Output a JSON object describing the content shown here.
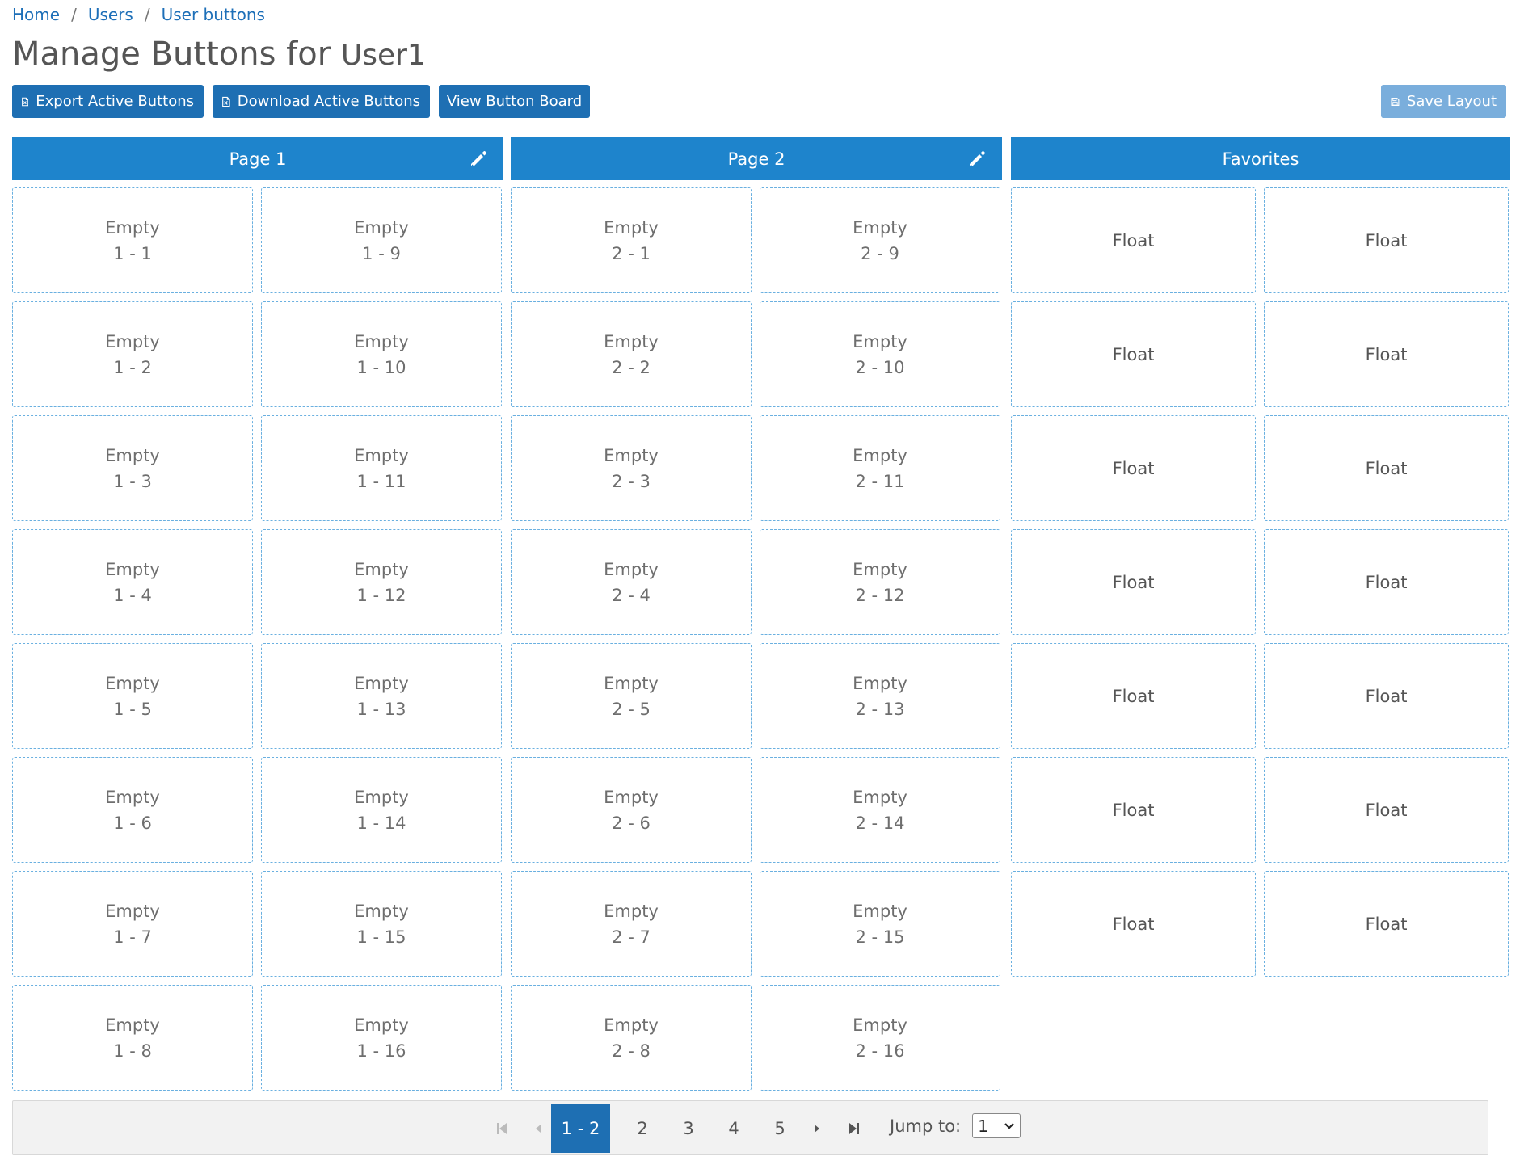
{
  "breadcrumb": {
    "home": "Home",
    "users": "Users",
    "current": "User buttons",
    "separator": "/"
  },
  "title": {
    "prefix": "Manage Buttons for",
    "user": "User1"
  },
  "toolbar": {
    "export_label": "Export Active Buttons",
    "download_label": "Download Active Buttons",
    "board_label": "View Button Board",
    "save_label": "Save Layout"
  },
  "columns": {
    "page1": "Page 1",
    "page2": "Page 2",
    "favorites": "Favorites"
  },
  "cell_status": "Empty",
  "page1_slots": [
    "1 - 1",
    "1 - 2",
    "1 - 3",
    "1 - 4",
    "1 - 5",
    "1 - 6",
    "1 - 7",
    "1 - 8",
    "1 - 9",
    "1 - 10",
    "1 - 11",
    "1 - 12",
    "1 - 13",
    "1 - 14",
    "1 - 15",
    "1 - 16"
  ],
  "page2_slots": [
    "2 - 1",
    "2 - 2",
    "2 - 3",
    "2 - 4",
    "2 - 5",
    "2 - 6",
    "2 - 7",
    "2 - 8",
    "2 - 9",
    "2 - 10",
    "2 - 11",
    "2 - 12",
    "2 - 13",
    "2 - 14",
    "2 - 15",
    "2 - 16"
  ],
  "favorites": [
    "Float",
    "Float",
    "Float",
    "Float",
    "Float",
    "Float",
    "Float",
    "Float",
    "Float",
    "Float",
    "Float",
    "Float",
    "Float",
    "Float"
  ],
  "pager": {
    "active": "1 - 2",
    "pages": [
      "2",
      "3",
      "4",
      "5"
    ],
    "jump_label": "Jump to:",
    "jump_value": "1"
  },
  "colors": {
    "primary": "#1e6fb3",
    "header": "#1e84cc",
    "save_disabled": "#7aaedc",
    "cell_border": "#6ab0e0"
  },
  "icons": [
    "excel-file-icon",
    "pencil-icon",
    "floppy-disk-icon",
    "first-page-icon",
    "prev-page-icon",
    "next-page-icon",
    "last-page-icon",
    "chevron-down-icon"
  ]
}
